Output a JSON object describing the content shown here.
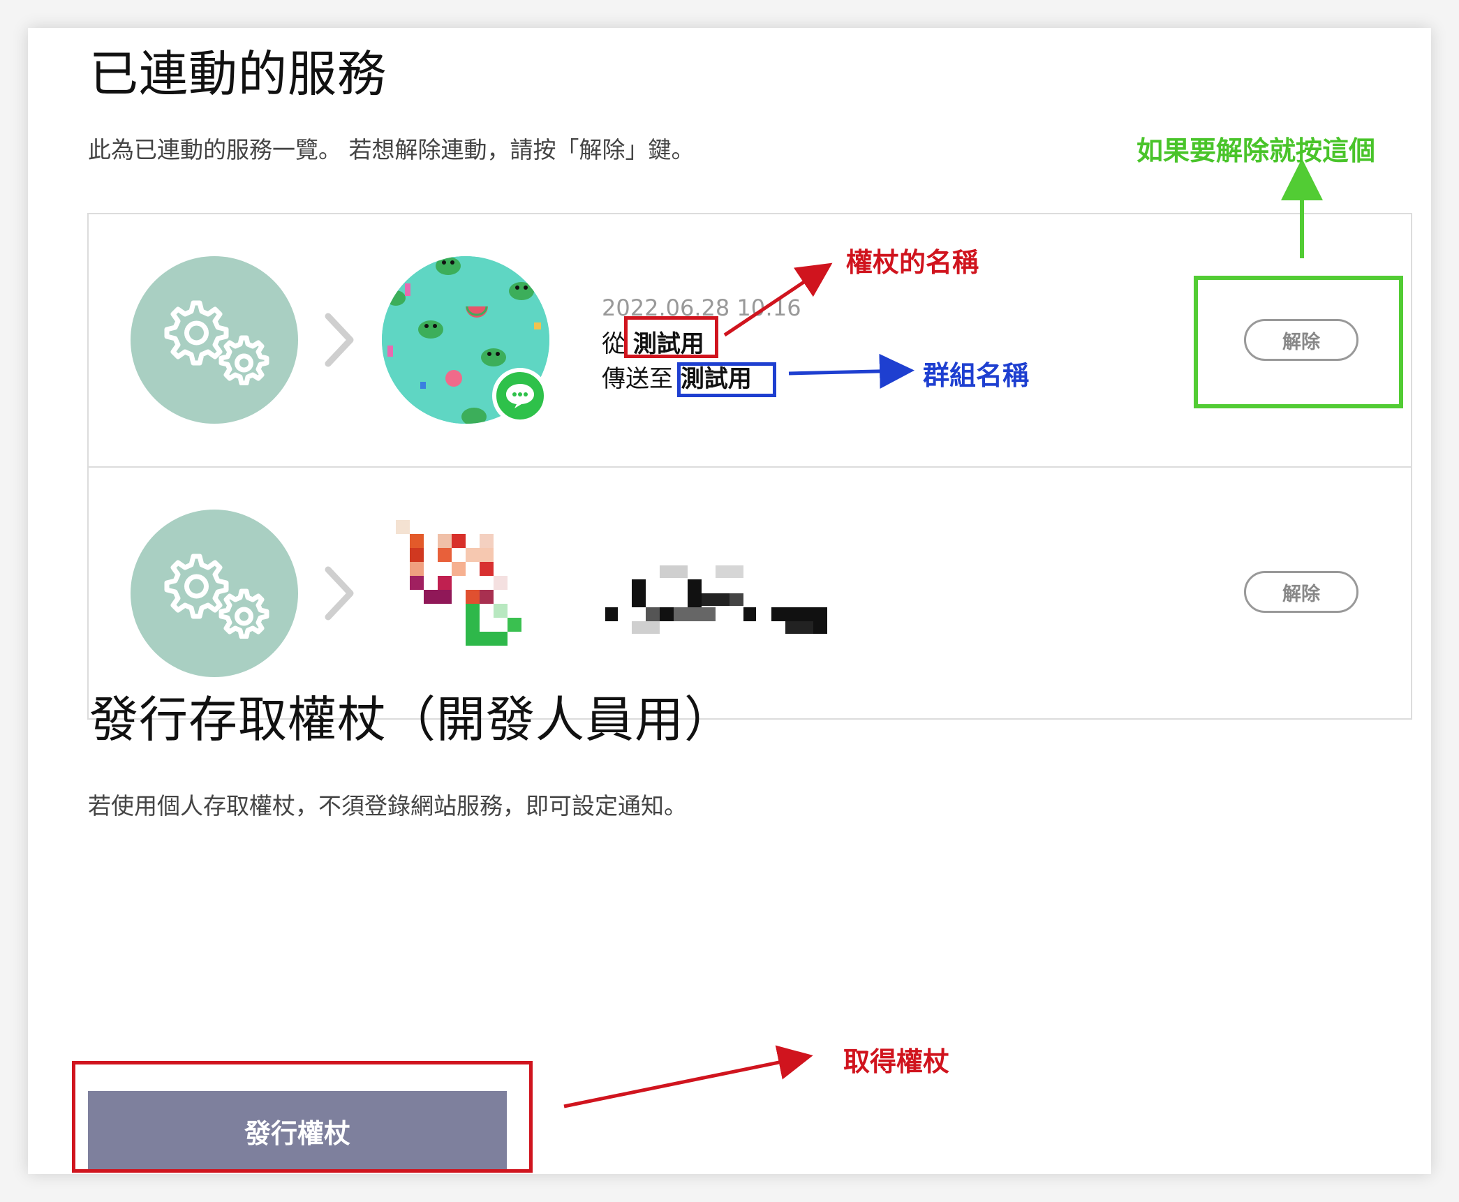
{
  "connected_services": {
    "title": "已連動的服務",
    "description": "此為已連動的服務一覽。 若想解除連動，請按「解除」鍵。",
    "items": [
      {
        "date": "2022.06.28 10:16",
        "from_prefix": "從",
        "from_name": "測試用",
        "to_prefix": "傳送至",
        "to_name": "測試用",
        "release_label": "解除"
      },
      {
        "release_label": "解除"
      }
    ]
  },
  "access_token": {
    "title": "發行存取權杖（開發人員用）",
    "description": "若使用個人存取權杖，不須登錄網站服務，即可設定通知。",
    "issue_label": "發行權杖"
  },
  "annotations": {
    "release_hint": "如果要解除就按這個",
    "token_name": "權杖的名稱",
    "group_name": "群組名稱",
    "get_token": "取得權杖"
  },
  "colors": {
    "annotation_red": "#d0141e",
    "annotation_blue": "#1e3fd0",
    "annotation_green": "#49c42a",
    "service_icon_bg": "#a9cfc2",
    "issue_button_bg": "#7e809d"
  }
}
